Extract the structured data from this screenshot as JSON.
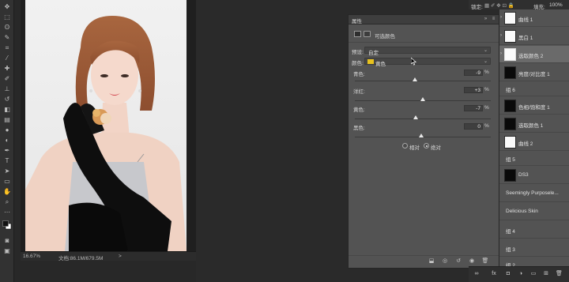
{
  "document": {
    "zoom": "16.67%",
    "doc_size": "文档:86.1M/679.5M",
    "status_arrow": ">"
  },
  "properties": {
    "title": "属性",
    "panel_type_label": "可选颜色",
    "preset_label": "预设:",
    "preset_value": "自定",
    "colors_label": "颜色:",
    "colors_value": "黄色",
    "colors_swatch": "#e8c21e",
    "sliders": [
      {
        "label": "青色:",
        "value": "-9",
        "unit": "%"
      },
      {
        "label": "洋红:",
        "value": "+3",
        "unit": "%"
      },
      {
        "label": "黄色:",
        "value": "-7",
        "unit": "%"
      },
      {
        "label": "黑色:",
        "value": "0",
        "unit": "%"
      }
    ],
    "method_relative": "相对",
    "method_absolute": "绝对",
    "method_selected": "absolute"
  },
  "layers_header": {
    "lock_label": "锁定:",
    "fill_label": "填充:",
    "fill_value": "100%"
  },
  "layers": [
    {
      "name": "曲线 1",
      "thumb": "white",
      "selected": false
    },
    {
      "name": "黑白 1",
      "thumb": "white",
      "selected": false
    },
    {
      "name": "选取颜色 2",
      "thumb": "white",
      "selected": true
    },
    {
      "name": "亮度/对比度 1",
      "thumb": "dark",
      "selected": false
    },
    {
      "name": "组 6",
      "thumb": "none",
      "selected": false
    },
    {
      "name": "色相/饱和度 1",
      "thumb": "dark",
      "selected": false
    },
    {
      "name": "选取颜色 1",
      "thumb": "dark",
      "selected": false
    },
    {
      "name": "曲线 2",
      "thumb": "white",
      "selected": false
    },
    {
      "name": "组 5",
      "thumb": "none",
      "selected": false
    },
    {
      "name": "DS3",
      "thumb": "dark",
      "selected": false
    },
    {
      "name": "Seemingly Purposele...",
      "thumb": "none",
      "selected": false
    },
    {
      "name": "Delicious Skin",
      "thumb": "none",
      "selected": false
    },
    {
      "name": "组 4",
      "thumb": "none",
      "selected": false
    },
    {
      "name": "组 3",
      "thumb": "none",
      "selected": false
    },
    {
      "name": "组 2",
      "thumb": "none",
      "selected": false
    }
  ],
  "toolbar_icons": [
    "move-icon",
    "marquee-icon",
    "lasso-icon",
    "quick-select-icon",
    "crop-icon",
    "eyedropper-icon",
    "healing-icon",
    "brush-icon",
    "stamp-icon",
    "history-brush-icon",
    "eraser-icon",
    "gradient-icon",
    "blur-icon",
    "dodge-icon",
    "pen-icon",
    "type-icon",
    "path-select-icon",
    "shape-icon",
    "hand-icon",
    "zoom-icon",
    "more-icon",
    "color-swatches-icon",
    "quickmask-icon",
    "screenmode-icon"
  ]
}
